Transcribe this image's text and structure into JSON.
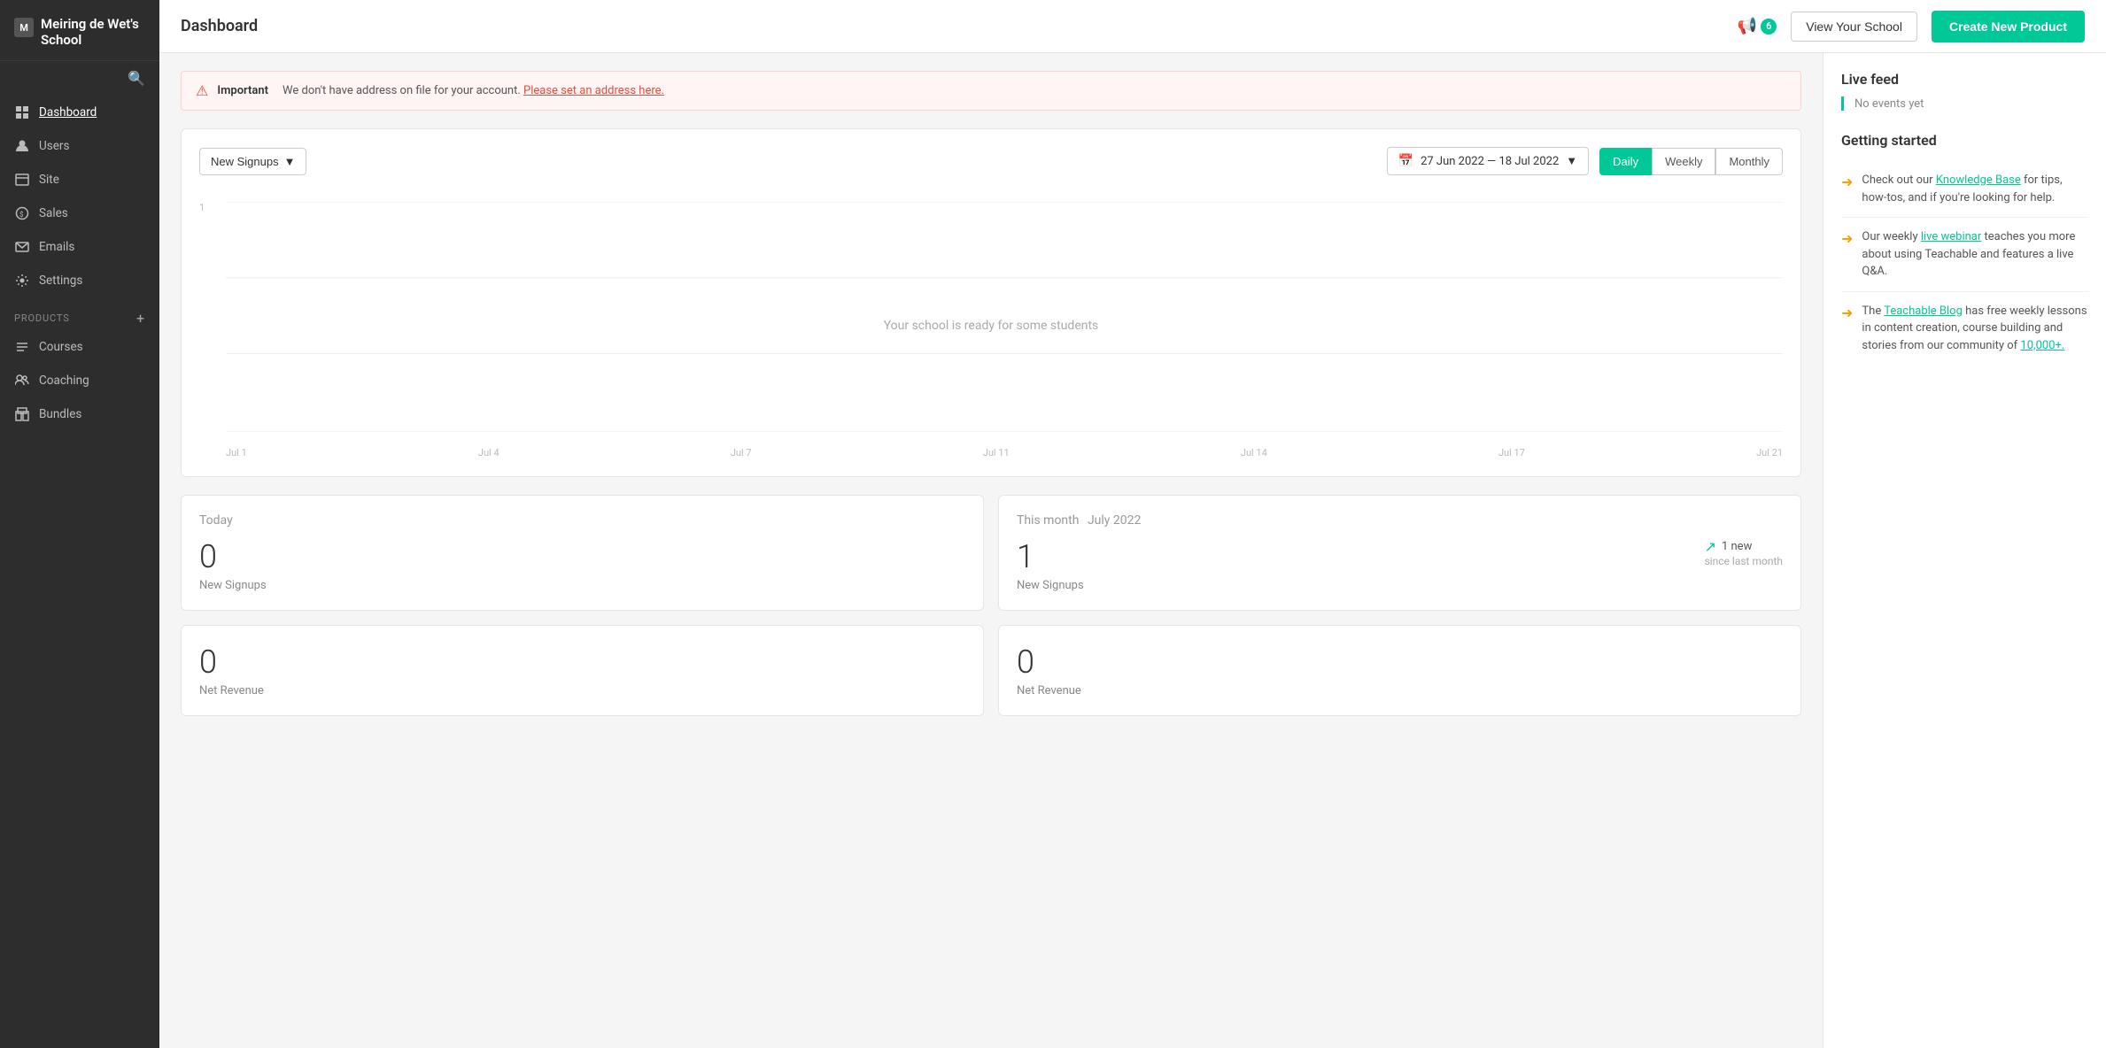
{
  "sidebar": {
    "brand": {
      "name": "Meiring de Wet's School"
    },
    "nav_items": [
      {
        "id": "dashboard",
        "label": "Dashboard",
        "active": true
      },
      {
        "id": "users",
        "label": "Users",
        "active": false
      },
      {
        "id": "site",
        "label": "Site",
        "active": false
      },
      {
        "id": "sales",
        "label": "Sales",
        "active": false
      },
      {
        "id": "emails",
        "label": "Emails",
        "active": false
      },
      {
        "id": "settings",
        "label": "Settings",
        "active": false
      }
    ],
    "products_label": "PRODUCTS",
    "product_items": [
      {
        "id": "courses",
        "label": "Courses"
      },
      {
        "id": "coaching",
        "label": "Coaching"
      },
      {
        "id": "bundles",
        "label": "Bundles"
      }
    ]
  },
  "topbar": {
    "title": "Dashboard",
    "notification_count": "6",
    "view_school_label": "View Your School",
    "create_product_label": "Create New Product"
  },
  "alert": {
    "label": "Important",
    "text": "We don't have address on file for your account.",
    "link_text": "Please set an address here."
  },
  "chart": {
    "dropdown_label": "New Signups",
    "date_range": "27 Jun 2022 — 18 Jul 2022",
    "period_buttons": [
      "Daily",
      "Weekly",
      "Monthly"
    ],
    "active_period": "Daily",
    "empty_text": "Your school is ready for some students",
    "y_labels": [
      "1",
      ""
    ],
    "x_labels": [
      "Jul 1",
      "Jul 4",
      "Jul 7",
      "Jul 11",
      "Jul 14",
      "Jul 17",
      "Jul 21"
    ]
  },
  "stats": {
    "today_label": "Today",
    "this_month_label": "This month",
    "month_value": "July 2022",
    "today_items": [
      {
        "value": "0",
        "label": "New Signups"
      },
      {
        "value": "0",
        "label": "Net Revenue"
      }
    ],
    "month_items": [
      {
        "value": "1",
        "label": "New Signups",
        "badge": "1 new",
        "badge_sub": "since last month"
      },
      {
        "value": "0",
        "label": "Net Revenue"
      }
    ]
  },
  "live_feed": {
    "title": "Live feed",
    "empty_text": "No events yet"
  },
  "getting_started": {
    "title": "Getting started",
    "items": [
      {
        "text_parts": [
          {
            "type": "normal",
            "text": "Check out our "
          },
          {
            "type": "link",
            "text": "Knowledge Base"
          },
          {
            "type": "normal",
            "text": " for tips, how-tos, and if you're looking for help."
          }
        ]
      },
      {
        "text_parts": [
          {
            "type": "normal",
            "text": "Our weekly "
          },
          {
            "type": "link",
            "text": "live webinar"
          },
          {
            "type": "normal",
            "text": " teaches you more about using Teachable and features a live Q&A."
          }
        ]
      },
      {
        "text_parts": [
          {
            "type": "normal",
            "text": "The "
          },
          {
            "type": "link",
            "text": "Teachable Blog"
          },
          {
            "type": "normal",
            "text": " has free weekly lessons in content creation, course building and stories from our community of "
          },
          {
            "type": "link",
            "text": "10,000+."
          }
        ]
      }
    ]
  }
}
